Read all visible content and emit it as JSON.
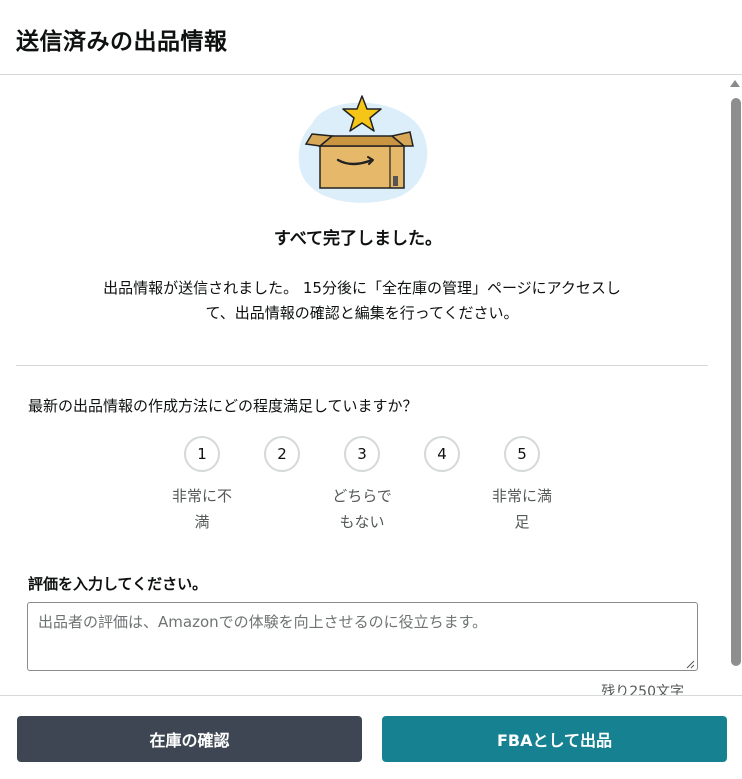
{
  "header": {
    "title": "送信済みの出品情報"
  },
  "completion": {
    "title": "すべて完了しました。",
    "message_line1": "出品情報が送信されました。 15分後に「全在庫の管理」ページにアクセスし",
    "message_line2": "て、出品情報の確認と編集を行ってください。"
  },
  "survey": {
    "question": "最新の出品情報の作成方法にどの程度満足していますか？",
    "ratings": [
      "1",
      "2",
      "3",
      "4",
      "5"
    ],
    "captions": {
      "low": [
        "非常に不",
        "満"
      ],
      "mid": [
        "どちらで",
        "もない"
      ],
      "high": [
        "非常に満",
        "足"
      ]
    }
  },
  "review": {
    "label": "評価を入力してください。",
    "placeholder": "出品者の評価は、Amazonでの体験を向上させるのに役立ちます。",
    "value": "",
    "char_count": "残り250文字"
  },
  "footer": {
    "inventory_button": "在庫の確認",
    "fba_button": "FBAとして出品"
  },
  "colors": {
    "primary_dark": "#3e4654",
    "primary_teal": "#168291",
    "star": "#f5c518",
    "box": "#e6b86a"
  },
  "icons": {
    "illustration": "amazon-box-with-star-icon",
    "scroll_up": "scroll-up-arrow-icon",
    "resize": "resize-grip-icon"
  }
}
